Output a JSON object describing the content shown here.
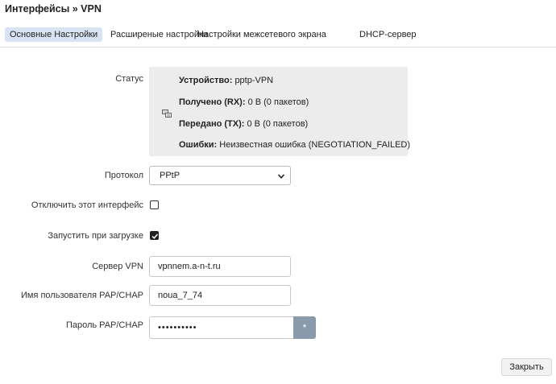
{
  "header": {
    "title": "Интерфейсы » VPN"
  },
  "tabs": [
    {
      "label": "Основные Настройки",
      "active": true
    },
    {
      "label": "Расширеные настройки",
      "active": false
    },
    {
      "label": "Настройки межсетевого экрана",
      "active": false
    },
    {
      "label": "DHCP-сервер",
      "active": false
    }
  ],
  "status": {
    "label": "Статус",
    "icon": "network-icon",
    "device_key": "Устройство:",
    "device_val": "pptp-VPN",
    "rx_key": "Получено (RX):",
    "rx_val": "0 B (0 пакетов)",
    "tx_key": "Передано (TX):",
    "tx_val": "0 B (0 пакетов)",
    "err_key": "Ошибки:",
    "err_val": "Неизвестная ошибка (NEGOTIATION_FAILED)"
  },
  "protocol": {
    "label": "Протокол",
    "value": "PPtP"
  },
  "disable_iface": {
    "label": "Отключить этот интерфейс",
    "checked": false
  },
  "autostart": {
    "label": "Запустить при загрузке",
    "checked": true
  },
  "server": {
    "label": "Сервер VPN",
    "value": "vpnnem.a-n-t.ru"
  },
  "username": {
    "label": "Имя пользователя PAP/CHAP",
    "value": "noua_7_74"
  },
  "password": {
    "label": "Пароль PAP/CHAP",
    "value": "••••••••••",
    "reveal_label": "*"
  },
  "footer": {
    "close_label": "Закрыть"
  },
  "colors": {
    "active_tab": "#d8e4f4",
    "status_bg": "#ececec",
    "reveal_button": "#8a9aad"
  }
}
